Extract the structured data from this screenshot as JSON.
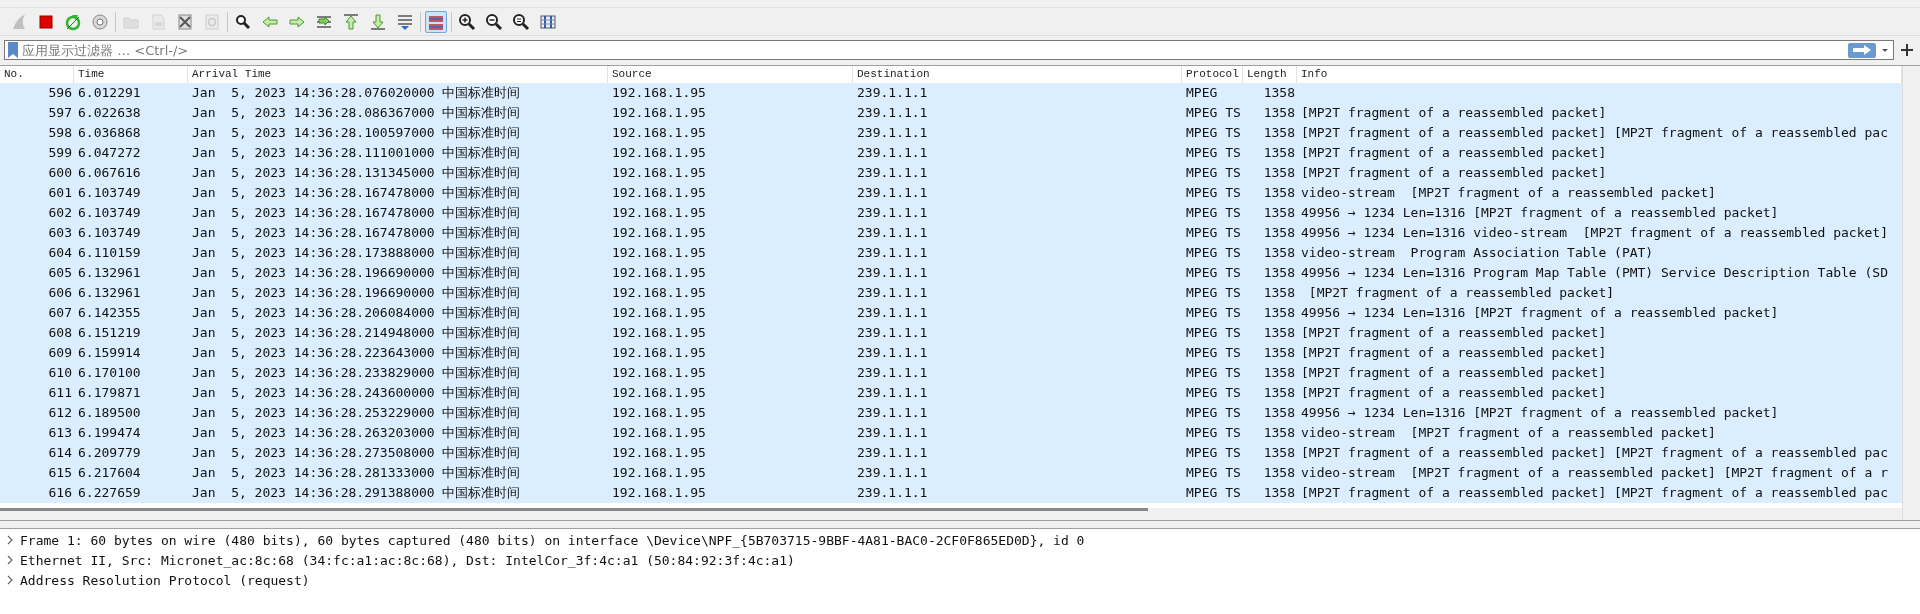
{
  "toolbar": {
    "groups": [
      [
        {
          "kind": "shark",
          "disabled": true,
          "pressed": false
        },
        {
          "kind": "stop",
          "disabled": false,
          "pressed": false
        },
        {
          "kind": "restart",
          "disabled": false,
          "pressed": false
        },
        {
          "kind": "options",
          "disabled": false,
          "pressed": false
        }
      ],
      [
        {
          "kind": "open",
          "disabled": true,
          "pressed": false
        },
        {
          "kind": "save",
          "disabled": true,
          "pressed": false
        },
        {
          "kind": "close",
          "disabled": false,
          "pressed": false
        },
        {
          "kind": "reload",
          "disabled": true,
          "pressed": false
        }
      ],
      [
        {
          "kind": "find",
          "disabled": false,
          "pressed": false
        },
        {
          "kind": "back",
          "disabled": false,
          "pressed": false
        },
        {
          "kind": "forward",
          "disabled": false,
          "pressed": false
        },
        {
          "kind": "goto",
          "disabled": false,
          "pressed": false
        },
        {
          "kind": "first",
          "disabled": false,
          "pressed": false
        },
        {
          "kind": "last",
          "disabled": false,
          "pressed": false
        },
        {
          "kind": "autoscroll",
          "disabled": false,
          "pressed": false
        }
      ],
      [
        {
          "kind": "colorize",
          "disabled": false,
          "pressed": true
        }
      ],
      [
        {
          "kind": "zoom-in",
          "disabled": false,
          "pressed": false
        },
        {
          "kind": "zoom-out",
          "disabled": false,
          "pressed": false
        },
        {
          "kind": "zoom-reset",
          "disabled": false,
          "pressed": false
        },
        {
          "kind": "resize",
          "disabled": false,
          "pressed": false
        }
      ]
    ]
  },
  "filter": {
    "placeholder": "应用显示过滤器 … <Ctrl-/>"
  },
  "table": {
    "columns": [
      "No.",
      "Time",
      "Arrival Time",
      "Source",
      "Destination",
      "Protocol",
      "Length",
      "Info"
    ],
    "rows": [
      {
        "no": "596",
        "time": "6.012291",
        "arrival": "Jan  5, 2023 14:36:28.076020000 中国标准时间",
        "source": "192.168.1.95",
        "destination": "239.1.1.1",
        "protocol": "MPEG",
        "length": "1358"
      },
      {
        "no": "597",
        "time": "6.022638",
        "arrival": "Jan  5, 2023 14:36:28.086367000 中国标准时间",
        "source": "192.168.1.95",
        "destination": "239.1.1.1",
        "protocol": "MPEG TS",
        "length": "1358",
        "info": "[MP2T fragment of a reassembled packet]"
      },
      {
        "no": "598",
        "time": "6.036868",
        "arrival": "Jan  5, 2023 14:36:28.100597000 中国标准时间",
        "source": "192.168.1.95",
        "destination": "239.1.1.1",
        "protocol": "MPEG TS",
        "length": "1358",
        "info": "[MP2T fragment of a reassembled packet] [MP2T fragment of a reassembled pac"
      },
      {
        "no": "599",
        "time": "6.047272",
        "arrival": "Jan  5, 2023 14:36:28.111001000 中国标准时间",
        "source": "192.168.1.95",
        "destination": "239.1.1.1",
        "protocol": "MPEG TS",
        "length": "1358",
        "info": "[MP2T fragment of a reassembled packet]"
      },
      {
        "no": "600",
        "time": "6.067616",
        "arrival": "Jan  5, 2023 14:36:28.131345000 中国标准时间",
        "source": "192.168.1.95",
        "destination": "239.1.1.1",
        "protocol": "MPEG TS",
        "length": "1358",
        "info": "[MP2T fragment of a reassembled packet]"
      },
      {
        "no": "601",
        "time": "6.103749",
        "arrival": "Jan  5, 2023 14:36:28.167478000 中国标准时间",
        "source": "192.168.1.95",
        "destination": "239.1.1.1",
        "protocol": "MPEG TS",
        "length": "1358",
        "info": "video-stream  [MP2T fragment of a reassembled packet]"
      },
      {
        "no": "602",
        "time": "6.103749",
        "arrival": "Jan  5, 2023 14:36:28.167478000 中国标准时间",
        "source": "192.168.1.95",
        "destination": "239.1.1.1",
        "protocol": "MPEG TS",
        "length": "1358",
        "info": "49956 → 1234 Len=1316 [MP2T fragment of a reassembled packet]"
      },
      {
        "no": "603",
        "time": "6.103749",
        "arrival": "Jan  5, 2023 14:36:28.167478000 中国标准时间",
        "source": "192.168.1.95",
        "destination": "239.1.1.1",
        "protocol": "MPEG TS",
        "length": "1358",
        "info": "49956 → 1234 Len=1316 video-stream  [MP2T fragment of a reassembled packet]"
      },
      {
        "no": "604",
        "time": "6.110159",
        "arrival": "Jan  5, 2023 14:36:28.173888000 中国标准时间",
        "source": "192.168.1.95",
        "destination": "239.1.1.1",
        "protocol": "MPEG TS",
        "length": "1358",
        "info": "video-stream  Program Association Table (PAT)"
      },
      {
        "no": "605",
        "time": "6.132961",
        "arrival": "Jan  5, 2023 14:36:28.196690000 中国标准时间",
        "source": "192.168.1.95",
        "destination": "239.1.1.1",
        "protocol": "MPEG TS",
        "length": "1358",
        "info": "49956 → 1234 Len=1316 Program Map Table (PMT) Service Description Table (SD"
      },
      {
        "no": "606",
        "time": "6.132961",
        "arrival": "Jan  5, 2023 14:36:28.196690000 中国标准时间",
        "source": "192.168.1.95",
        "destination": "239.1.1.1",
        "protocol": "MPEG TS",
        "length": "1358",
        "info": " [MP2T fragment of a reassembled packet]"
      },
      {
        "no": "607",
        "time": "6.142355",
        "arrival": "Jan  5, 2023 14:36:28.206084000 中国标准时间",
        "source": "192.168.1.95",
        "destination": "239.1.1.1",
        "protocol": "MPEG TS",
        "length": "1358",
        "info": "49956 → 1234 Len=1316 [MP2T fragment of a reassembled packet]"
      },
      {
        "no": "608",
        "time": "6.151219",
        "arrival": "Jan  5, 2023 14:36:28.214948000 中国标准时间",
        "source": "192.168.1.95",
        "destination": "239.1.1.1",
        "protocol": "MPEG TS",
        "length": "1358",
        "info": "[MP2T fragment of a reassembled packet]"
      },
      {
        "no": "609",
        "time": "6.159914",
        "arrival": "Jan  5, 2023 14:36:28.223643000 中国标准时间",
        "source": "192.168.1.95",
        "destination": "239.1.1.1",
        "protocol": "MPEG TS",
        "length": "1358",
        "info": "[MP2T fragment of a reassembled packet]"
      },
      {
        "no": "610",
        "time": "6.170100",
        "arrival": "Jan  5, 2023 14:36:28.233829000 中国标准时间",
        "source": "192.168.1.95",
        "destination": "239.1.1.1",
        "protocol": "MPEG TS",
        "length": "1358",
        "info": "[MP2T fragment of a reassembled packet]"
      },
      {
        "no": "611",
        "time": "6.179871",
        "arrival": "Jan  5, 2023 14:36:28.243600000 中国标准时间",
        "source": "192.168.1.95",
        "destination": "239.1.1.1",
        "protocol": "MPEG TS",
        "length": "1358",
        "info": "[MP2T fragment of a reassembled packet]"
      },
      {
        "no": "612",
        "time": "6.189500",
        "arrival": "Jan  5, 2023 14:36:28.253229000 中国标准时间",
        "source": "192.168.1.95",
        "destination": "239.1.1.1",
        "protocol": "MPEG TS",
        "length": "1358",
        "info": "49956 → 1234 Len=1316 [MP2T fragment of a reassembled packet]"
      },
      {
        "no": "613",
        "time": "6.199474",
        "arrival": "Jan  5, 2023 14:36:28.263203000 中国标准时间",
        "source": "192.168.1.95",
        "destination": "239.1.1.1",
        "protocol": "MPEG TS",
        "length": "1358",
        "info": "video-stream  [MP2T fragment of a reassembled packet]"
      },
      {
        "no": "614",
        "time": "6.209779",
        "arrival": "Jan  5, 2023 14:36:28.273508000 中国标准时间",
        "source": "192.168.1.95",
        "destination": "239.1.1.1",
        "protocol": "MPEG TS",
        "length": "1358",
        "info": "[MP2T fragment of a reassembled packet] [MP2T fragment of a reassembled pac"
      },
      {
        "no": "615",
        "time": "6.217604",
        "arrival": "Jan  5, 2023 14:36:28.281333000 中国标准时间",
        "source": "192.168.1.95",
        "destination": "239.1.1.1",
        "protocol": "MPEG TS",
        "length": "1358",
        "info": "video-stream  [MP2T fragment of a reassembled packet] [MP2T fragment of a r"
      },
      {
        "no": "616",
        "time": "6.227659",
        "arrival": "Jan  5, 2023 14:36:28.291388000 中国标准时间",
        "source": "192.168.1.95",
        "destination": "239.1.1.1",
        "protocol": "MPEG TS",
        "length": "1358",
        "info": "[MP2T fragment of a reassembled packet] [MP2T fragment of a reassembled pac"
      }
    ]
  },
  "details": {
    "items": [
      {
        "label": "Frame 1: 60 bytes on wire (480 bits), 60 bytes captured (480 bits) on interface \\Device\\NPF_{5B703715-9BBF-4A81-BAC0-2CF0F865ED0D}, id 0",
        "expanded": false
      },
      {
        "label": "Ethernet II, Src: Micronet_ac:8c:68 (34:fc:a1:ac:8c:68), Dst: IntelCor_3f:4c:a1 (50:84:92:3f:4c:a1)",
        "expanded": false
      },
      {
        "label": "Address Resolution Protocol (request)",
        "expanded": false
      }
    ]
  }
}
